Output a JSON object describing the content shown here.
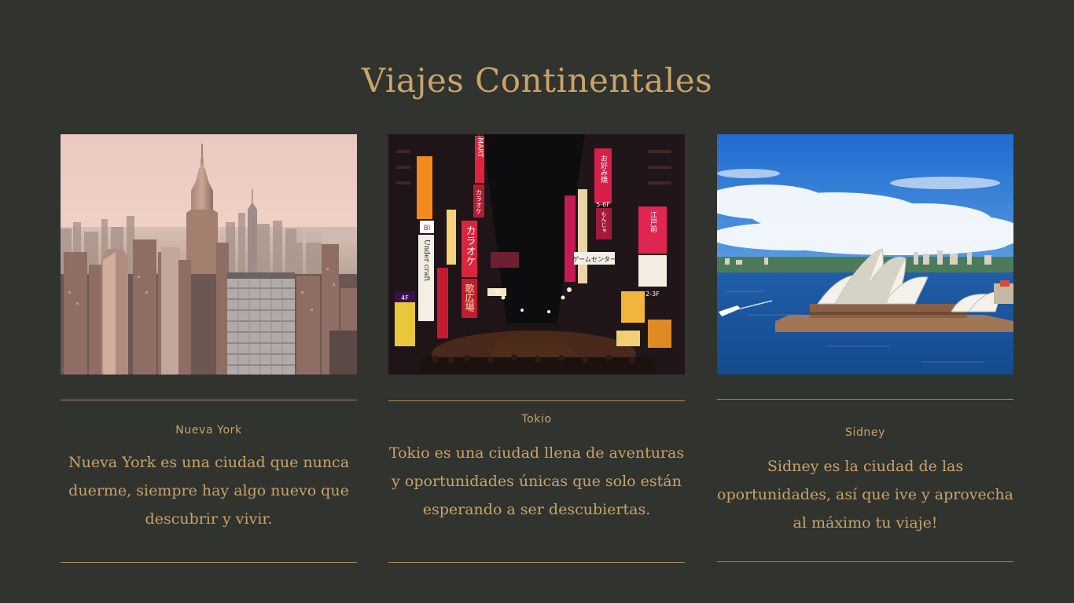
{
  "slide": {
    "title": "Viajes Continentales"
  },
  "cards": [
    {
      "name": "Nueva York",
      "description": "Nueva York es una ciudad que nunca duerme, siempre hay algo nuevo que descubrir y vivir."
    },
    {
      "name": "Tokio",
      "description": "Tokio es una ciudad llena de aventuras y oportunidades únicas que solo están esperando a ser descubiertas."
    },
    {
      "name": "Sidney",
      "description": "Sidney es la ciudad de las oportunidades, así que ive y aprovecha al máximo tu viaje!"
    }
  ],
  "photos": {
    "tokyo_signs": [
      "C-MART",
      "カラオケ",
      "歌広場",
      "お好み焼",
      "もんじゃ",
      "Under craft",
      "BI",
      "ゲームセンター",
      "江戸前",
      "5-6F",
      "2-3F",
      "4F"
    ]
  },
  "colors": {
    "background": "#30332e",
    "accent": "#c9a36a",
    "rule": "#a98a5c"
  }
}
